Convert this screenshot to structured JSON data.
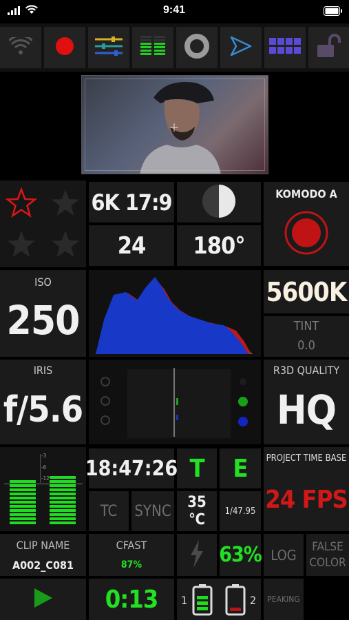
{
  "status": {
    "time": "9:41"
  },
  "toolbar": {
    "icons": [
      "wifi-icon",
      "record-icon",
      "sliders-icon",
      "audio-meter-icon",
      "focus-ring-icon",
      "send-icon",
      "grid-icon",
      "lock-icon"
    ]
  },
  "camera": {
    "name": "KOMODO A"
  },
  "format": {
    "resolution": "6K 17:9",
    "fps": "24",
    "shutter": "180°"
  },
  "exposure": {
    "iso_label": "ISO",
    "iso": "250",
    "iris_label": "IRIS",
    "iris": "f/5.6"
  },
  "color": {
    "white_balance": "5600K",
    "tint_label": "TINT",
    "tint": "0.0"
  },
  "quality": {
    "label": "R3D QUALITY",
    "value": "HQ"
  },
  "audio_scale": [
    "-3",
    "-6",
    "-12"
  ],
  "timecode": {
    "time": "18:47:26",
    "tc_label": "TC",
    "sync_label": "SYNC",
    "t_label": "T",
    "e_label": "E",
    "temp": "35 ℃",
    "shutter_time": "1/47.95"
  },
  "project": {
    "timebase_label": "PROJECT TIME BASE",
    "timebase": "24 FPS"
  },
  "clip": {
    "name_label": "CLIP NAME",
    "name": "A002_C081",
    "media_label": "CFAST",
    "media_pct": "87%",
    "battery_pct": "63%",
    "log_label": "LOG",
    "false_color_label": "FALSE COLOR",
    "peaking_label": "PEAKING",
    "duration": "0:13",
    "battery1": "1",
    "battery2": "2"
  },
  "colors": {
    "accent_green": "#22e022",
    "record_red": "#d01818"
  }
}
